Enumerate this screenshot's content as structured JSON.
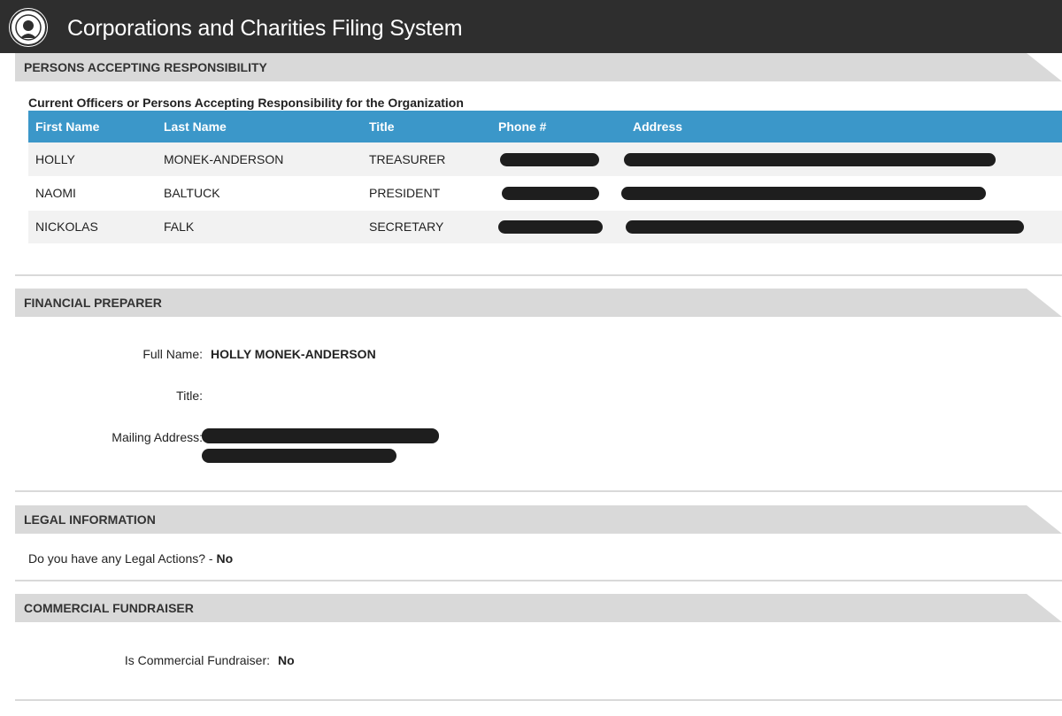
{
  "app": {
    "title": "Corporations and Charities Filing System",
    "logo": "state-seal-icon"
  },
  "responsibility": {
    "section_title": "PERSONS ACCEPTING RESPONSIBILITY",
    "subtitle": "Current Officers or Persons Accepting Responsibility for the Organization",
    "columns": [
      "First Name",
      "Last Name",
      "Title",
      "Phone #",
      "Address"
    ],
    "rows": [
      {
        "first": "HOLLY",
        "last": "MONEK-ANDERSON",
        "title": "TREASURER",
        "phone": "[redacted]",
        "address": "[redacted]"
      },
      {
        "first": "NAOMI",
        "last": "BALTUCK",
        "title": "PRESIDENT",
        "phone": "[redacted]",
        "address": "[redacted]"
      },
      {
        "first": "NICKOLAS",
        "last": "FALK",
        "title": "SECRETARY",
        "phone": "[redacted]",
        "address": "[redacted]"
      }
    ]
  },
  "financial_preparer": {
    "section_title": "FINANCIAL PREPARER",
    "full_name_label": "Full Name:",
    "full_name": "HOLLY MONEK-ANDERSON",
    "title_label": "Title:",
    "title": "",
    "mailing_label": "Mailing Address:",
    "mailing_address": "[redacted]"
  },
  "legal": {
    "section_title": "LEGAL INFORMATION",
    "question": "Do you have any Legal Actions? -",
    "answer": "No"
  },
  "commercial": {
    "section_title": "COMMERCIAL FUNDRAISER",
    "label": "Is Commercial Fundraiser:",
    "value": "No"
  },
  "colors": {
    "topbar": "#2e2e2e",
    "table_header": "#3b97c9",
    "panel_header": "#d9d9d9"
  }
}
